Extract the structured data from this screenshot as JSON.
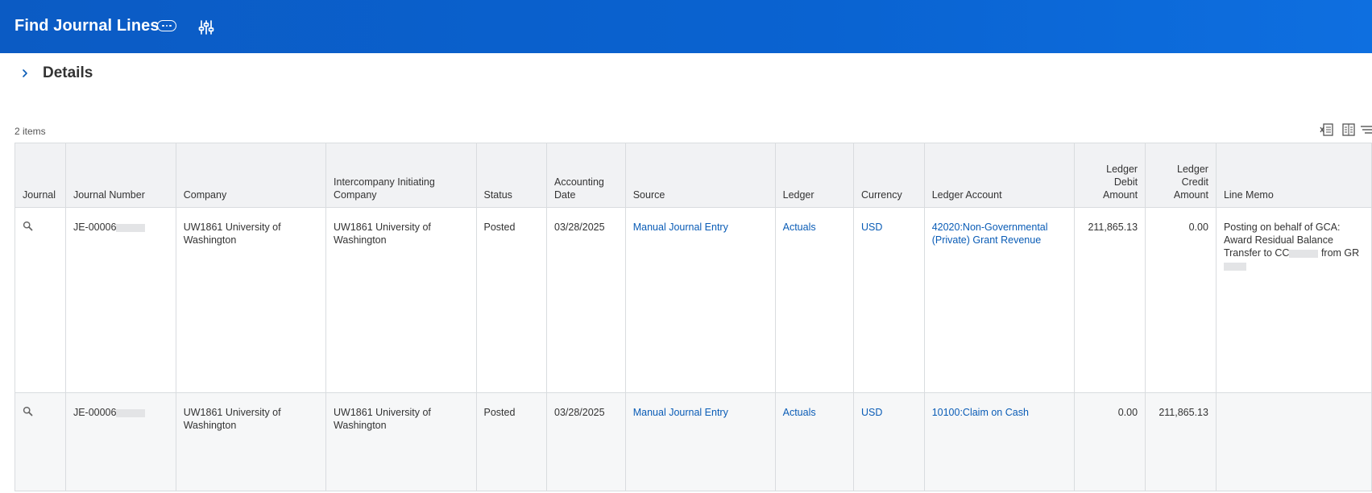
{
  "header": {
    "title": "Find Journal Lines",
    "accent_color": "#0a63d1"
  },
  "details": {
    "label": "Details"
  },
  "grid": {
    "item_count": "2 items",
    "toolbar_icons": [
      "export-to-excel-icon",
      "column-chooser-icon",
      "filter-icon"
    ],
    "columns": {
      "journal": "Journal",
      "journal_number": "Journal Number",
      "company": "Company",
      "intercompany": "Intercompany Initiating Company",
      "status": "Status",
      "accounting_date": "Accounting Date",
      "source": "Source",
      "ledger": "Ledger",
      "currency": "Currency",
      "ledger_account": "Ledger Account",
      "debit": "Ledger Debit Amount",
      "credit": "Ledger Credit Amount",
      "line_memo": "Line Memo"
    },
    "rows": [
      {
        "journal_number": "JE-00006",
        "company": "UW1861 University of Washington",
        "intercompany": "UW1861 University of Washington",
        "status": "Posted",
        "accounting_date": "03/28/2025",
        "source": "Manual Journal Entry",
        "ledger": "Actuals",
        "currency": "USD",
        "ledger_account": "42020:Non-Governmental (Private) Grant Revenue",
        "debit": "211,865.13",
        "credit": "0.00",
        "memo_part1": "Posting on behalf of GCA: Award Residual Balance Transfer to CC",
        "memo_part2": " from GR"
      },
      {
        "journal_number": "JE-00006",
        "company": "UW1861 University of Washington",
        "intercompany": "UW1861 University of Washington",
        "status": "Posted",
        "accounting_date": "03/28/2025",
        "source": "Manual Journal Entry",
        "ledger": "Actuals",
        "currency": "USD",
        "ledger_account": "10100:Claim on Cash",
        "debit": "0.00",
        "credit": "211,865.13",
        "memo_part1": "",
        "memo_part2": ""
      }
    ]
  }
}
